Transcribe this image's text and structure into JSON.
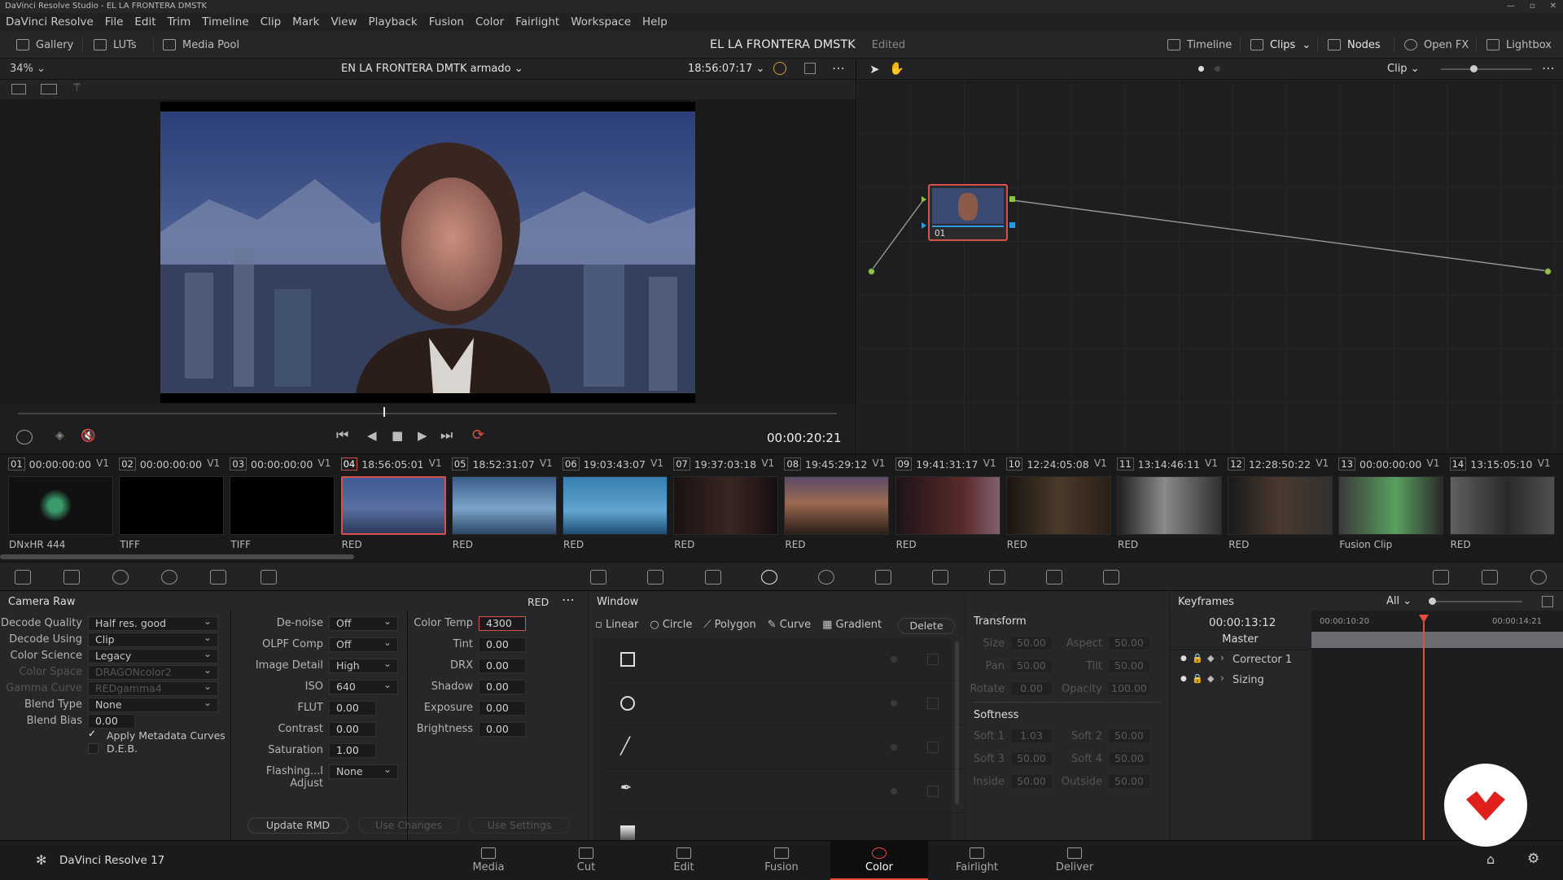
{
  "titlebar": {
    "title": "DaVinci Resolve Studio - EL LA FRONTERA DMSTK"
  },
  "menu": [
    "DaVinci Resolve",
    "File",
    "Edit",
    "Trim",
    "Timeline",
    "Clip",
    "Mark",
    "View",
    "Playback",
    "Fusion",
    "Color",
    "Fairlight",
    "Workspace",
    "Help"
  ],
  "toolbar": {
    "gallery": "Gallery",
    "luts": "LUTs",
    "media_pool": "Media Pool",
    "project_title": "EL LA FRONTERA DMSTK",
    "project_status": "Edited",
    "timeline": "Timeline",
    "clips": "Clips",
    "nodes": "Nodes",
    "openfx": "Open FX",
    "lightbox": "Lightbox"
  },
  "viewer": {
    "zoom": "34%",
    "timeline_name": "EN LA FRONTERA DMTK armado",
    "timecode": "18:56:07:17",
    "playhead_tc": "00:00:20:21"
  },
  "nodes": {
    "mode": "Clip",
    "node_label": "01"
  },
  "clips": [
    {
      "num": "01",
      "tc": "00:00:00:00",
      "track": "V1",
      "format": "DNxHR 444"
    },
    {
      "num": "02",
      "tc": "00:00:00:00",
      "track": "V1",
      "format": "TIFF"
    },
    {
      "num": "03",
      "tc": "00:00:00:00",
      "track": "V1",
      "format": "TIFF"
    },
    {
      "num": "04",
      "tc": "18:56:05:01",
      "track": "V1",
      "format": "RED"
    },
    {
      "num": "05",
      "tc": "18:52:31:07",
      "track": "V1",
      "format": "RED"
    },
    {
      "num": "06",
      "tc": "19:03:43:07",
      "track": "V1",
      "format": "RED"
    },
    {
      "num": "07",
      "tc": "19:37:03:18",
      "track": "V1",
      "format": "RED"
    },
    {
      "num": "08",
      "tc": "19:45:29:12",
      "track": "V1",
      "format": "RED"
    },
    {
      "num": "09",
      "tc": "19:41:31:17",
      "track": "V1",
      "format": "RED"
    },
    {
      "num": "10",
      "tc": "12:24:05:08",
      "track": "V1",
      "format": "RED"
    },
    {
      "num": "11",
      "tc": "13:14:46:11",
      "track": "V1",
      "format": "RED"
    },
    {
      "num": "12",
      "tc": "12:28:50:22",
      "track": "V1",
      "format": "RED"
    },
    {
      "num": "13",
      "tc": "00:00:00:00",
      "track": "V1",
      "format": "Fusion Clip"
    },
    {
      "num": "14",
      "tc": "13:15:05:10",
      "track": "V1",
      "format": "RED"
    }
  ],
  "camera_raw": {
    "title": "Camera Raw",
    "source": "RED",
    "decode_quality_label": "Decode Quality",
    "decode_quality": "Half res. good",
    "decode_using_label": "Decode Using",
    "decode_using": "Clip",
    "color_science_label": "Color Science",
    "color_science": "Legacy",
    "color_space_label": "Color Space",
    "color_space": "DRAGONcolor2",
    "gamma_curve_label": "Gamma Curve",
    "gamma_curve": "REDgamma4",
    "blend_type_label": "Blend Type",
    "blend_type": "None",
    "blend_bias_label": "Blend Bias",
    "blend_bias": "0.00",
    "apply_metadata": "Apply Metadata Curves",
    "deb": "D.E.B.",
    "denoise_label": "De-noise",
    "denoise": "Off",
    "olpf_label": "OLPF Comp",
    "olpf": "Off",
    "image_detail_label": "Image Detail",
    "image_detail": "High",
    "iso_label": "ISO",
    "iso": "640",
    "flut_label": "FLUT",
    "flut": "0.00",
    "contrast_label": "Contrast",
    "contrast": "0.00",
    "saturation_label": "Saturation",
    "saturation": "1.00",
    "flashing_label": "Flashing...l Adjust",
    "flashing": "None",
    "color_temp_label": "Color Temp",
    "color_temp": "4300",
    "tint_label": "Tint",
    "tint": "0.00",
    "drx_label": "DRX",
    "drx": "0.00",
    "shadow_label": "Shadow",
    "shadow": "0.00",
    "exposure_label": "Exposure",
    "exposure": "0.00",
    "brightness_label": "Brightness",
    "brightness": "0.00",
    "update_rmd": "Update RMD",
    "use_changes": "Use Changes",
    "use_settings": "Use Settings"
  },
  "window": {
    "title": "Window",
    "linear": "Linear",
    "circle": "Circle",
    "polygon": "Polygon",
    "curve": "Curve",
    "gradient": "Gradient",
    "delete": "Delete"
  },
  "transform": {
    "title": "Transform",
    "size_label": "Size",
    "size": "50.00",
    "aspect_label": "Aspect",
    "aspect": "50.00",
    "pan_label": "Pan",
    "pan": "50.00",
    "tilt_label": "Tilt",
    "tilt": "50.00",
    "rotate_label": "Rotate",
    "rotate": "0.00",
    "opacity_label": "Opacity",
    "opacity": "100.00",
    "softness_title": "Softness",
    "soft1_label": "Soft 1",
    "soft1": "1.03",
    "soft2_label": "Soft 2",
    "soft2": "50.00",
    "soft3_label": "Soft 3",
    "soft3": "50.00",
    "soft4_label": "Soft 4",
    "soft4": "50.00",
    "inside_label": "Inside",
    "inside": "50.00",
    "outside_label": "Outside",
    "outside": "50.00"
  },
  "keyframes": {
    "title": "Keyframes",
    "filter": "All",
    "current_tc": "00:00:13:12",
    "tc_start": "00:00:10:20",
    "tc_end": "00:00:14:21",
    "master": "Master",
    "corrector": "Corrector 1",
    "sizing": "Sizing"
  },
  "pages": {
    "app_name": "DaVinci Resolve 17",
    "media": "Media",
    "cut": "Cut",
    "edit": "Edit",
    "fusion": "Fusion",
    "color": "Color",
    "fairlight": "Fairlight",
    "deliver": "Deliver"
  },
  "colors": {
    "accent": "#e64b3c",
    "node_border": "#d4524a",
    "link_green": "#8cc63f",
    "link_blue": "#2d9be0"
  }
}
